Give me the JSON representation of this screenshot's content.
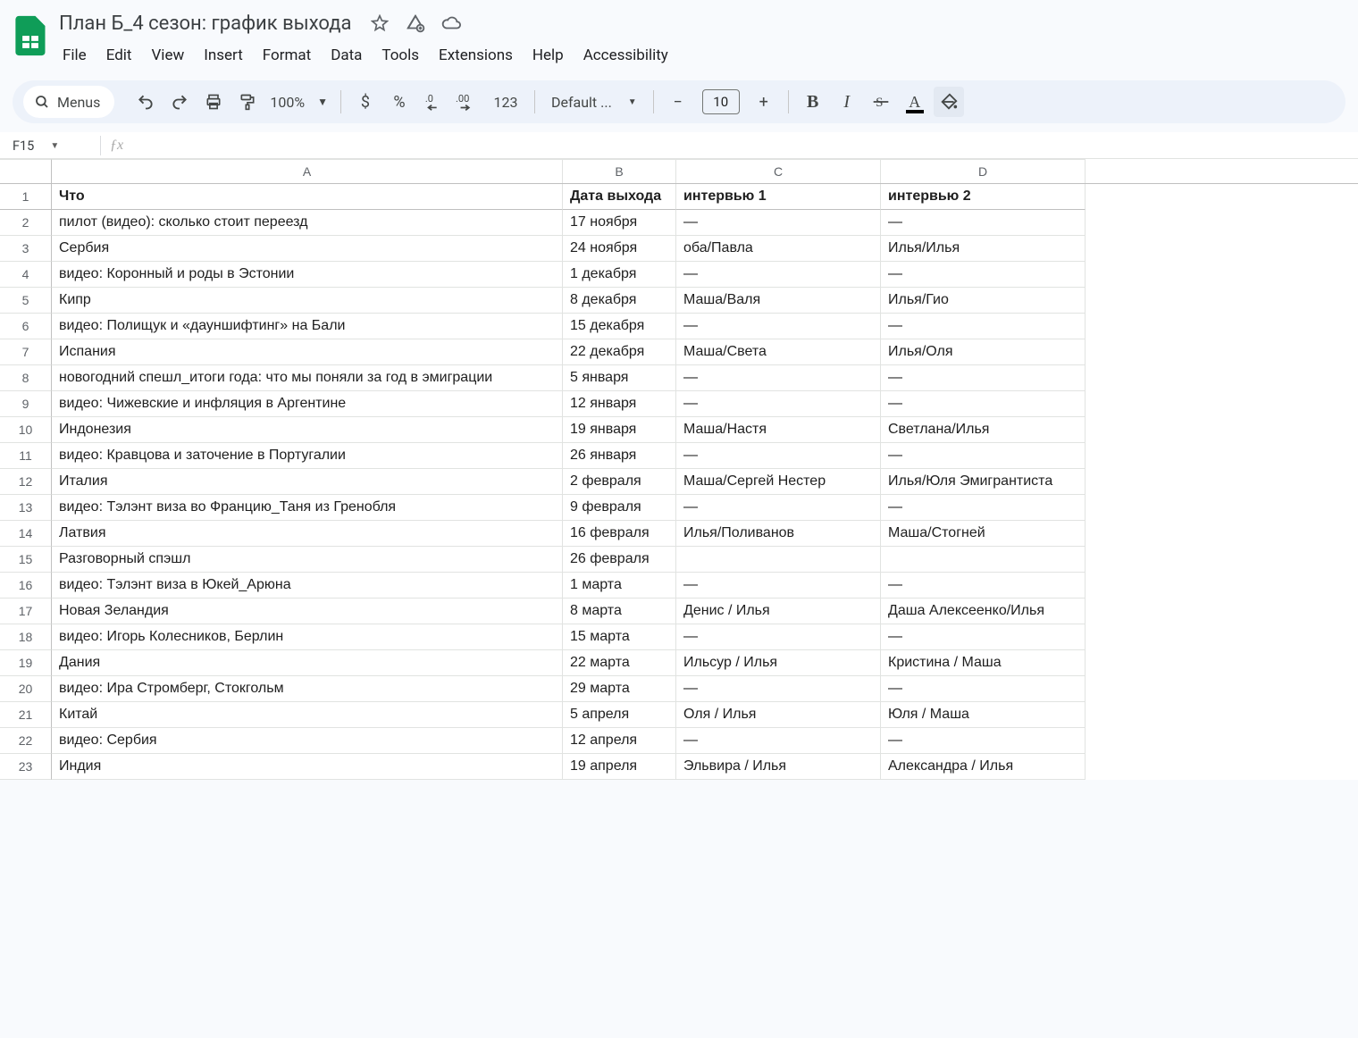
{
  "doc": {
    "title": "План Б_4 сезон: график выхода"
  },
  "menus": [
    "File",
    "Edit",
    "View",
    "Insert",
    "Format",
    "Data",
    "Tools",
    "Extensions",
    "Help",
    "Accessibility"
  ],
  "toolbar": {
    "search_label": "Menus",
    "zoom": "100%",
    "font": "Default ...",
    "font_size": "10",
    "fmt": {
      "currency": "$",
      "percent": "%",
      "dec_dec": ".0",
      "inc_dec": ".00",
      "num": "123"
    }
  },
  "namebox": "F15",
  "fx": "",
  "columns": [
    "A",
    "B",
    "C",
    "D"
  ],
  "headers": [
    "Что",
    "Дата выхода",
    "интервью 1",
    "интервью 2"
  ],
  "rows": [
    [
      "пилот (видео): сколько стоит переезд",
      "17 ноября",
      "—",
      "—"
    ],
    [
      "Сербия",
      "24 ноября",
      "оба/Павла",
      "Илья/Илья"
    ],
    [
      "видео: Коронный и роды в Эстонии",
      "1 декабря",
      "—",
      "—"
    ],
    [
      "Кипр",
      "8 декабря",
      "Маша/Валя",
      "Илья/Гио"
    ],
    [
      "видео: Полищук и «дауншифтинг» на Бали",
      "15 декабря",
      "—",
      "—"
    ],
    [
      "Испания",
      "22 декабря",
      "Маша/Света",
      "Илья/Оля"
    ],
    [
      "новогодний спешл_итоги года: что мы поняли за год в эмиграции",
      "5 января",
      "—",
      "—"
    ],
    [
      "видео: Чижевские и инфляция в Аргентине",
      "12 января",
      "—",
      "—"
    ],
    [
      "Индонезия",
      "19 января",
      "Маша/Настя",
      "Светлана/Илья"
    ],
    [
      "видео: Кравцова и заточение в Португалии",
      "26 января",
      "—",
      "—"
    ],
    [
      "Италия",
      "2 февраля",
      "Маша/Сергей Нестер",
      "Илья/Юля Эмигрантиста"
    ],
    [
      "видео: Тэлэнт виза во Францию_Таня из Гренобля",
      "9 февраля",
      "—",
      "—"
    ],
    [
      "Латвия",
      "16 февраля",
      "Илья/Поливанов",
      "Маша/Стогней"
    ],
    [
      "Разговорный спэшл",
      "26 февраля",
      "",
      ""
    ],
    [
      "видео: Тэлэнт виза в Юкей_Арюна",
      "1 марта",
      "—",
      "—"
    ],
    [
      "Новая Зеландия",
      "8 марта",
      "Денис / Илья",
      "Даша Алексеенко/Илья"
    ],
    [
      "видео: Игорь Колесников, Берлин",
      "15 марта",
      "—",
      "—"
    ],
    [
      "Дания",
      "22 марта",
      "Ильсур / Илья",
      "Кристина / Маша"
    ],
    [
      "видео: Ира Стромберг, Стокгольм",
      "29 марта",
      "—",
      "—"
    ],
    [
      "Китай",
      "5 апреля",
      "Оля / Илья",
      "Юля / Маша"
    ],
    [
      "видео: Сербия",
      "12 апреля",
      "—",
      "—"
    ],
    [
      "Индия",
      "19 апреля",
      "Эльвира / Илья",
      "Александра / Илья"
    ]
  ]
}
